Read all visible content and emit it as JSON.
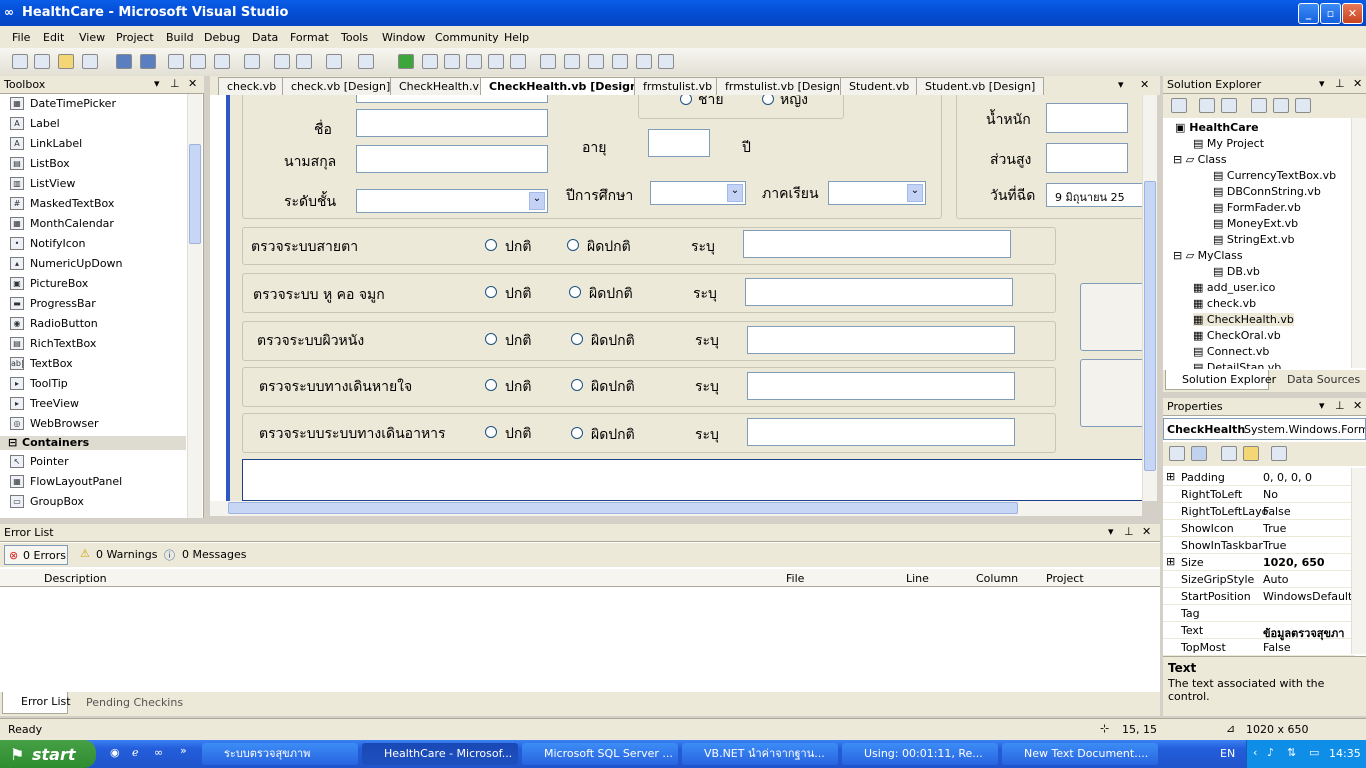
{
  "window": {
    "title": "HealthCare - Microsoft Visual Studio",
    "btn_min": "_",
    "btn_max": "▫",
    "btn_close": "✕"
  },
  "menu": [
    "File",
    "Edit",
    "View",
    "Project",
    "Build",
    "Debug",
    "Data",
    "Format",
    "Tools",
    "Window",
    "Community",
    "Help"
  ],
  "toolbox": {
    "title": "Toolbox",
    "items": [
      "DateTimePicker",
      "Label",
      "LinkLabel",
      "ListBox",
      "ListView",
      "MaskedTextBox",
      "MonthCalendar",
      "NotifyIcon",
      "NumericUpDown",
      "PictureBox",
      "ProgressBar",
      "RadioButton",
      "RichTextBox",
      "TextBox",
      "ToolTip",
      "TreeView",
      "WebBrowser"
    ],
    "icons": [
      "▦",
      "A",
      "A",
      "▤",
      "▥",
      "#",
      "▦",
      "•",
      "▴",
      "▣",
      "▬",
      "◉",
      "▤",
      "ab|",
      "▸",
      "▸",
      "◎"
    ],
    "section": "Containers",
    "container_items": [
      "Pointer",
      "FlowLayoutPanel",
      "GroupBox"
    ],
    "container_icons": [
      "↖",
      "▦",
      "▭"
    ]
  },
  "doc_tabs": [
    "check.vb",
    "check.vb [Design]",
    "CheckHealth.vb",
    "CheckHealth.vb [Design]",
    "frmstulist.vb",
    "frmstulist.vb [Design]",
    "Student.vb",
    "Student.vb [Design]"
  ],
  "active_tab": 3,
  "form": {
    "radio_male": "ชาย",
    "radio_female": "หญิง",
    "label_name": "ชื่อ",
    "label_surname": "นามสกุล",
    "label_grade": "ระดับชั้น",
    "label_age": "อายุ",
    "label_year_unit": "ปี",
    "label_academic_year": "ปีการศึกษา",
    "label_semester": "ภาคเรียน",
    "label_weight": "น้ำหนัก",
    "label_height": "ส่วนสูง",
    "label_date": "วันที่ฉีด",
    "date_value": "9  มิถุนายน    25",
    "normal": "ปกติ",
    "abnormal": "ผิดปกติ",
    "specify": "ระบุ",
    "checks": [
      "ตรวจระบบสายตา",
      "ตรวจระบบ หู คอ จมูก",
      "ตรวจระบบผิวหนัง",
      "ตรวจระบบทางเดินหายใจ",
      "ตรวจระบบระบบทางเดินอาหาร"
    ]
  },
  "solution_explorer": {
    "title": "Solution Explorer",
    "items": [
      {
        "label": "HealthCare",
        "bold": true
      },
      {
        "label": "My Project"
      },
      {
        "label": "Class"
      },
      {
        "label": "CurrencyTextBox.vb"
      },
      {
        "label": "DBConnString.vb"
      },
      {
        "label": "FormFader.vb"
      },
      {
        "label": "MoneyExt.vb"
      },
      {
        "label": "StringExt.vb"
      },
      {
        "label": "MyClass"
      },
      {
        "label": "DB.vb"
      },
      {
        "label": "add_user.ico"
      },
      {
        "label": "check.vb"
      },
      {
        "label": "CheckHealth.vb"
      },
      {
        "label": "CheckOral.vb"
      },
      {
        "label": "Connect.vb"
      },
      {
        "label": "DetailStan.vb"
      }
    ],
    "tab1": "Solution Explorer",
    "tab2": "Data Sources"
  },
  "properties": {
    "title": "Properties",
    "object": "CheckHealth",
    "object_type": "System.Windows.Form",
    "rows": [
      {
        "k": "Padding",
        "v": "0, 0, 0, 0"
      },
      {
        "k": "RightToLeft",
        "v": "No"
      },
      {
        "k": "RightToLeftLayo",
        "v": "False"
      },
      {
        "k": "ShowIcon",
        "v": "True"
      },
      {
        "k": "ShowInTaskbar",
        "v": "True"
      },
      {
        "k": "Size",
        "v": "1020, 650"
      },
      {
        "k": "SizeGripStyle",
        "v": "Auto"
      },
      {
        "k": "StartPosition",
        "v": "WindowsDefaultL"
      },
      {
        "k": "Tag",
        "v": ""
      },
      {
        "k": "Text",
        "v": "ข้อมูลตรวจสุขภา"
      },
      {
        "k": "TopMost",
        "v": "False"
      }
    ],
    "desc_title": "Text",
    "desc_text": "The text associated with the control."
  },
  "error_list": {
    "title": "Error List",
    "errors": "0 Errors",
    "warnings": "0 Warnings",
    "messages": "0 Messages",
    "cols": [
      "Description",
      "File",
      "Line",
      "Column",
      "Project"
    ],
    "tab1": "Error List",
    "tab2": "Pending Checkins"
  },
  "status": {
    "text": "Ready",
    "pos": "15, 15",
    "size": "1020 x 650"
  },
  "taskbar": {
    "start": "start",
    "tasks": [
      "ระบบตรวจสุขภาพ",
      "HealthCare - Microsof...",
      "Microsoft SQL Server ...",
      "VB.NET นำค่าจากฐาน...",
      "Using: 00:01:11, Re...",
      "New Text Document...."
    ],
    "lang": "EN",
    "clock": "14:35"
  }
}
